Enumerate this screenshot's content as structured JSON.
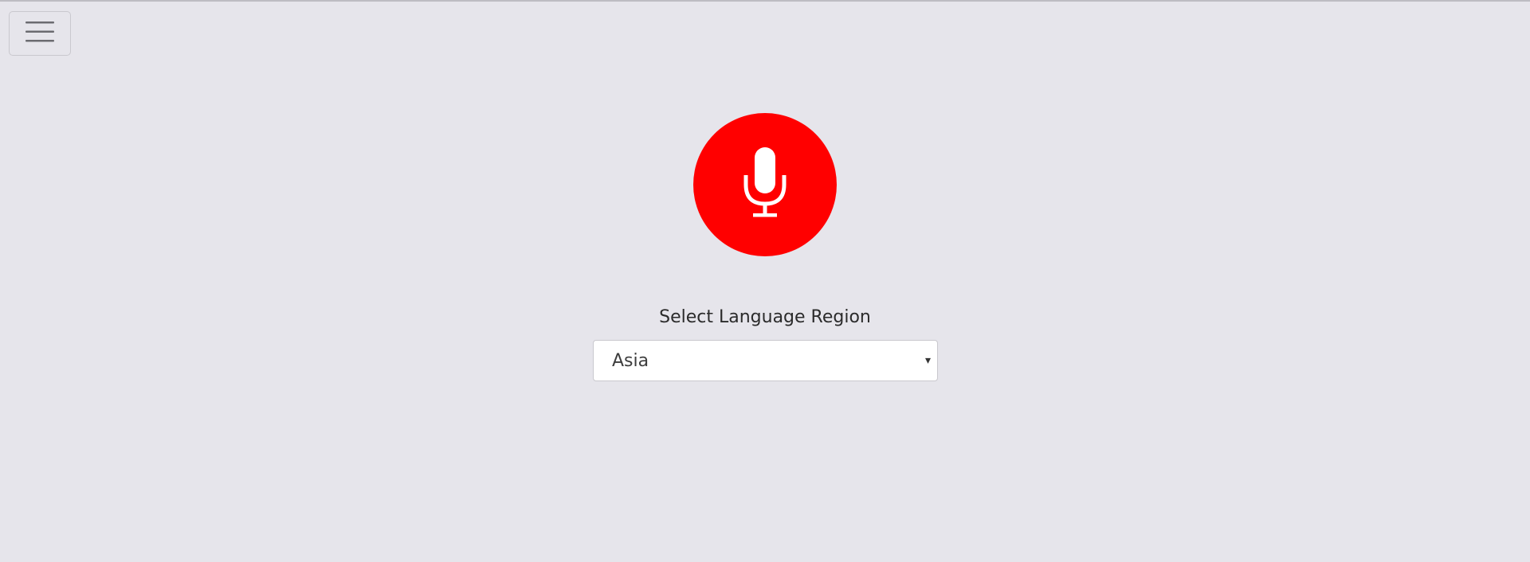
{
  "toolbar": {
    "menu_icon": "hamburger-menu-icon"
  },
  "mic": {
    "icon": "microphone-icon",
    "color": "#ff0000"
  },
  "region": {
    "label": "Select Language Region",
    "selected": "Asia",
    "arrow": "▾"
  },
  "colors": {
    "background": "#e6e5eb",
    "accent": "#ff0000"
  }
}
